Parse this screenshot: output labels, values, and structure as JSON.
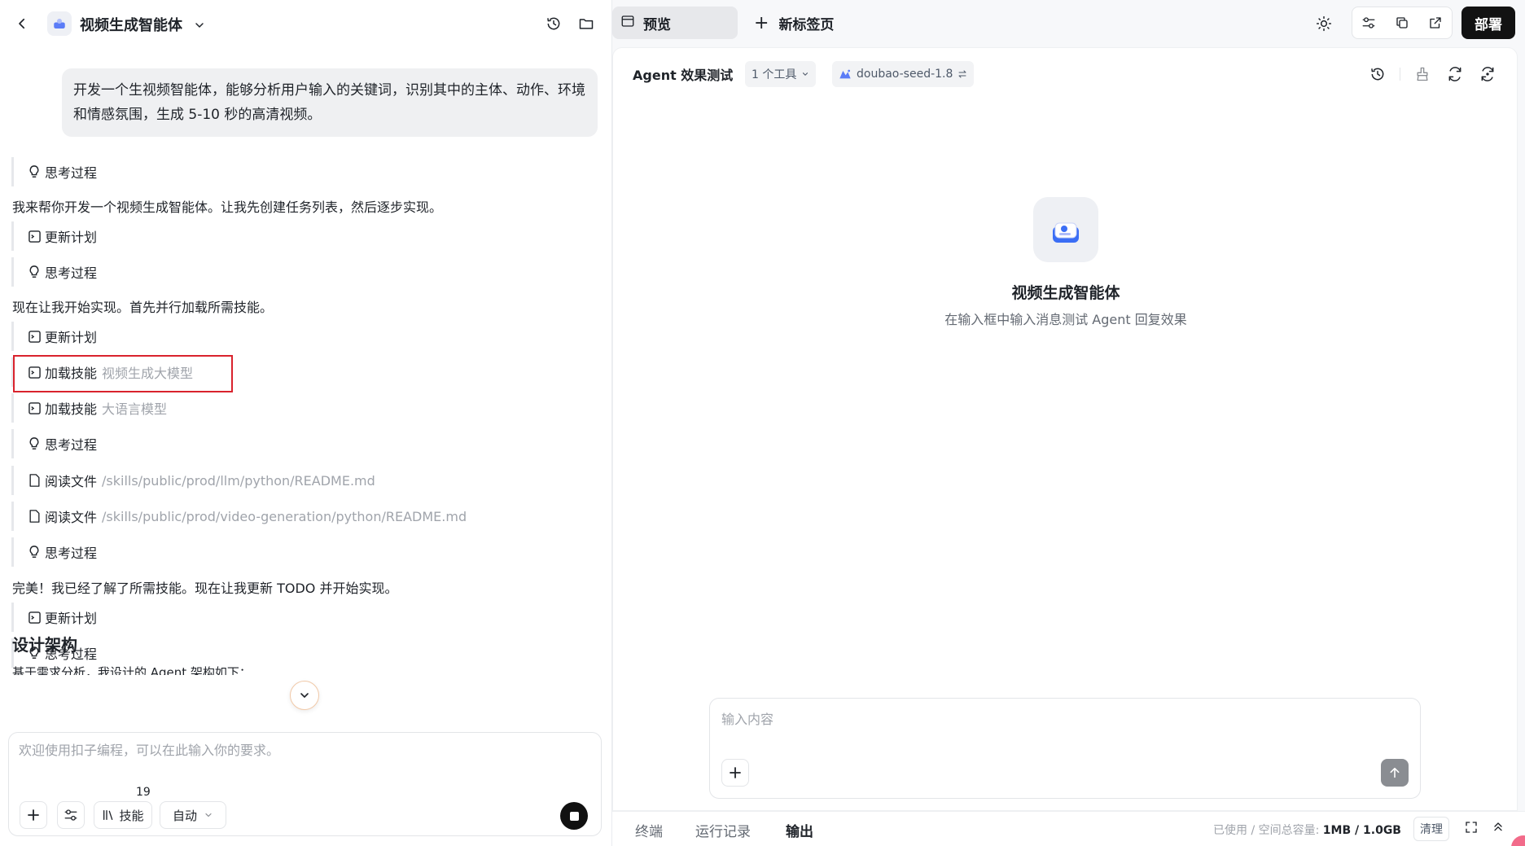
{
  "header": {
    "agent_title": "视频生成智能体"
  },
  "chat": {
    "user_message": "开发一个生视频智能体，能够分析用户输入的关键词，识别其中的主体、动作、环境和情感氛围，生成 5-10 秒的高清视频。",
    "items": [
      {
        "label": "思考过程"
      },
      {
        "text": "我来帮你开发一个视频生成智能体。让我先创建任务列表，然后逐步实现。"
      },
      {
        "label": "更新计划"
      },
      {
        "label": "思考过程"
      },
      {
        "text": "现在让我开始实现。首先并行加载所需技能。"
      },
      {
        "label": "更新计划"
      },
      {
        "label": "加载技能",
        "sub": "视频生成大模型"
      },
      {
        "label": "加载技能",
        "sub": "大语言模型"
      },
      {
        "label": "思考过程"
      },
      {
        "label": "阅读文件",
        "sub": "/skills/public/prod/llm/python/README.md"
      },
      {
        "label": "阅读文件",
        "sub": "/skills/public/prod/video-generation/python/README.md"
      },
      {
        "label": "思考过程"
      },
      {
        "text": "完美！我已经了解了所需技能。现在让我更新 TODO 并开始实现。"
      },
      {
        "label": "更新计划"
      },
      {
        "label": "思考过程"
      }
    ],
    "section_title": "设计架构",
    "section_text": "基于需求分析，我设计的 Agent 架构如下："
  },
  "composer": {
    "placeholder": "欢迎使用扣子编程，可以在此输入你的要求。",
    "skill_label": "技能",
    "skill_count": "19",
    "mode_label": "自动"
  },
  "right_tabs": {
    "preview": "预览",
    "new_tab": "新标签页",
    "deploy": "部署"
  },
  "preview": {
    "title": "Agent 效果测试",
    "tools": "1 个工具",
    "model": "doubao-seed-1.8",
    "empty_title": "视频生成智能体",
    "empty_sub": "在输入框中输入消息测试 Agent 回复效果",
    "input_placeholder": "输入内容"
  },
  "bottom": {
    "tabs": [
      "终端",
      "运行记录",
      "输出"
    ],
    "storage_label": "已使用 / 空间总容量: ",
    "used": "1MB",
    "sep": " / ",
    "total": "1.0GB",
    "clean": "清理"
  },
  "colors": {
    "highlight": "#d9232d",
    "deploy_bg": "#121212",
    "accent_blue": "#3b6ef5"
  }
}
